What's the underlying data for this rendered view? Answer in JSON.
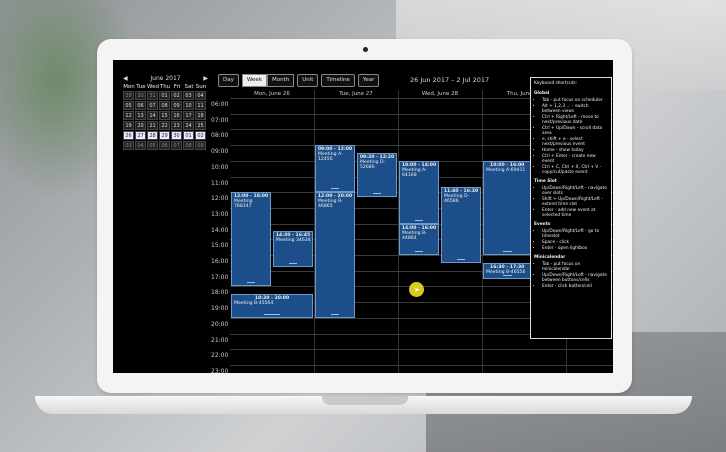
{
  "minicalendar": {
    "prev": "◀",
    "next": "▶",
    "month": "June 2017",
    "weekdays": [
      "Mon",
      "Tue",
      "Wed",
      "Thu",
      "Fri",
      "Sat",
      "Sun"
    ],
    "days": [
      "29",
      "30",
      "31",
      "01",
      "02",
      "03",
      "04",
      "05",
      "06",
      "07",
      "08",
      "09",
      "10",
      "11",
      "12",
      "13",
      "14",
      "15",
      "16",
      "17",
      "18",
      "19",
      "20",
      "21",
      "22",
      "23",
      "24",
      "25",
      "26",
      "27",
      "28",
      "29",
      "30",
      "01",
      "02",
      "03",
      "04",
      "05",
      "06",
      "07",
      "08",
      "09"
    ]
  },
  "toolbar": {
    "day": "Day",
    "week": "Week",
    "month": "Month",
    "unit": "Unit",
    "timeline": "Timeline",
    "year": "Year",
    "range": "26 Jun 2017 – 2 Jul 2017"
  },
  "calendar": {
    "days": [
      "Mon, June 26",
      "Tue, June 27",
      "Wed, June 28",
      "Thu, June 29"
    ],
    "hours": [
      "06:00",
      "07:00",
      "08:00",
      "09:00",
      "10:00",
      "11:00",
      "12:00",
      "13:00",
      "14:00",
      "15:00",
      "16:00",
      "17:00",
      "18:00",
      "19:00",
      "20:00",
      "21:00",
      "22:00",
      "23:00"
    ],
    "events": [
      {
        "time": "12:00 - 18:00",
        "name": "Meeting 788347"
      },
      {
        "time": "14:30 - 16:45",
        "name": "Meeting 34634"
      },
      {
        "time": "18:30 - 20:00",
        "name": "Meeting B-45564"
      },
      {
        "time": "09:00 - 12:00",
        "name": "Meeting A-12456"
      },
      {
        "time": "12:00 - 20:00",
        "name": "Meeting B-46865"
      },
      {
        "time": "09:30 - 12:20",
        "name": "Meeting D-52686"
      },
      {
        "time": "10:00 - 14:00",
        "name": "Meeting A-64168"
      },
      {
        "time": "14:00 - 16:00",
        "name": "Meeting B-44864"
      },
      {
        "time": "11:40 - 16:30",
        "name": "Meeting D-46586"
      },
      {
        "time": "10:00 - 16:00",
        "name": "Meeting A-69411"
      },
      {
        "time": "16:30 - 17:30",
        "name": "Meeting B-46556"
      }
    ]
  },
  "shortcuts": {
    "title": "Keyboard shortcuts:",
    "sections": [
      {
        "name": "Global",
        "items": [
          "Tab - put focus on scheduler",
          "Alt + 1,2,3 ... - switch between views",
          "Ctrl + Right/Left - move to next/previous date",
          "Ctrl + Up/Down - scroll data area",
          "e, shift + e - select next/previous event",
          "Home - show today",
          "Ctrl + Enter - create new event",
          "Ctrl + C, Ctrl + X, Ctrl + V - copy/cut/paste event"
        ]
      },
      {
        "name": "Time Slot",
        "items": [
          "Up/Down/Right/Left - navigate over slots",
          "Shift + Up/Down/Right/Left - extend time slot",
          "Enter - add new event at selected time"
        ]
      },
      {
        "name": "Events",
        "items": [
          "Up/Down/Right/Left - go to timeslot",
          "Space - click",
          "Enter - open lightbox"
        ]
      },
      {
        "name": "Minicalendar",
        "items": [
          "Tab - put focus on minicalendar",
          "Up/Down/Right/Left - navigate between buttons/cells",
          "Enter - click button/cell"
        ]
      }
    ]
  }
}
